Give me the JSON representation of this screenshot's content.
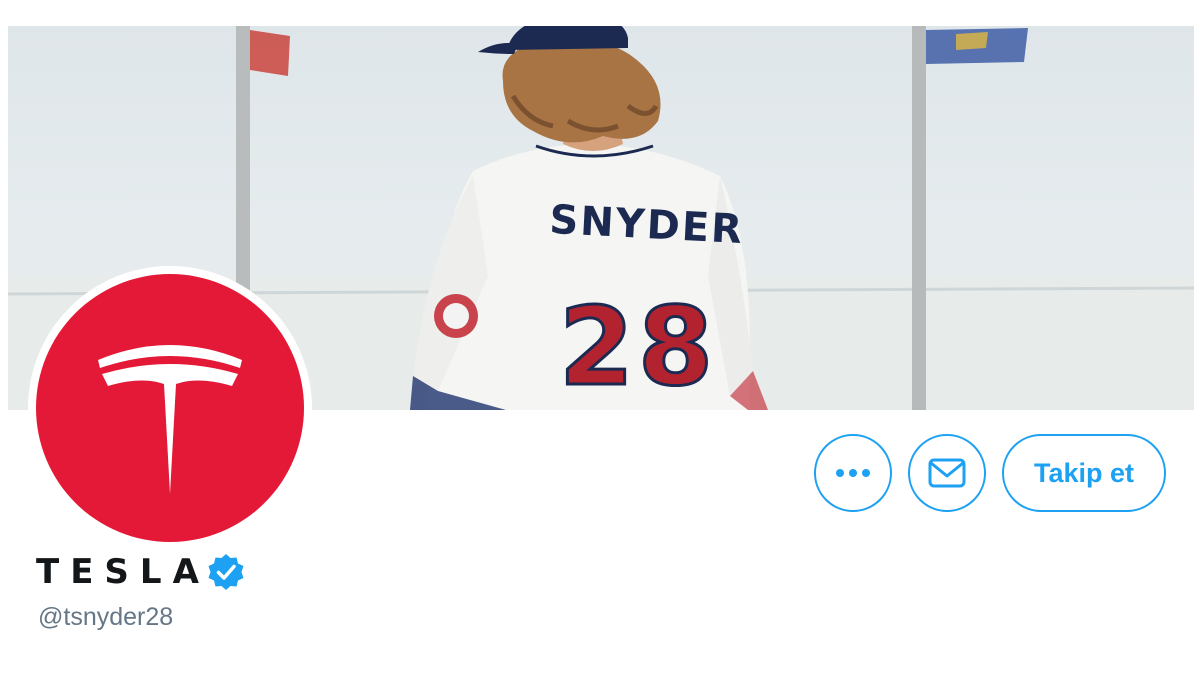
{
  "banner": {
    "jersey_name": "SNYDER",
    "jersey_number": "28"
  },
  "profile": {
    "display_name": "TESLA",
    "handle": "@tsnyder28",
    "verified": true
  },
  "actions": {
    "more_icon": "more-horizontal-icon",
    "message_icon": "envelope-icon",
    "follow_label": "Takip et"
  },
  "colors": {
    "accent": "#1da1f2",
    "avatar_bg": "#e31937",
    "handle_text": "#657786",
    "name_text": "#14171a"
  }
}
